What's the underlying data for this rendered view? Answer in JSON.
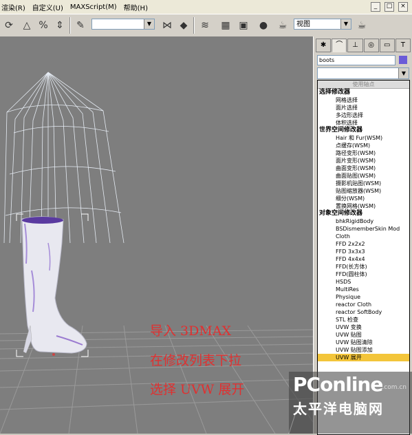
{
  "menubar": {
    "items": [
      "渲染(R)",
      "自定义(U)",
      "MAXScript(M)",
      "帮助(H)"
    ],
    "window_buttons": [
      "_",
      "□",
      "×"
    ]
  },
  "toolbar": {
    "selection_set_value": "",
    "viewport_select_value": "视图"
  },
  "command_panel": {
    "tabs": [
      "create-icon",
      "modify-icon",
      "hierarchy-icon",
      "motion-icon",
      "display-icon",
      "utilities-icon"
    ],
    "object_name": "boots",
    "object_color": "#6a5bd8",
    "modifier_dropdown_value": "",
    "list_header": "使用轴点",
    "groups": [
      {
        "title": "选择修改器",
        "items": [
          "网格选择",
          "面片选择",
          "多边形选择",
          "体积选择"
        ]
      },
      {
        "title": "世界空间修改器",
        "items": [
          "Hair 和 Fur(WSM)",
          "点缓存(WSM)",
          "路径变形(WSM)",
          "面片变形(WSM)",
          "曲面变形(WSM)",
          "曲面贴图(WSM)",
          "摄影机贴图(WSM)",
          "贴图缩放器(WSM)",
          "细分(WSM)",
          "置换网格(WSM)"
        ]
      },
      {
        "title": "对象空间修改器",
        "items": [
          "bhkRigidBody",
          "BSDismemberSkin Mod",
          "Cloth",
          "FFD 2x2x2",
          "FFD 3x3x3",
          "FFD 4x4x4",
          "FFD(长方体)",
          "FFD(圆柱体)",
          "HSDS",
          "MultiRes",
          "Physique",
          "reactor Cloth",
          "reactor SoftBody",
          "STL 检查",
          "UVW 变换",
          "UVW 贴图",
          "UVW 贴图清除",
          "UVW 贴图添加",
          "UVW 展开"
        ]
      }
    ],
    "selected_item": "UVW 展开"
  },
  "annotation": {
    "line1": "导入 3DMAX",
    "line2": "在修改列表下拉",
    "line3": "选择 UVW 展开"
  },
  "watermark": {
    "brand": "PConline",
    "domain": ".com.cn",
    "chinese": "太平洋电脑网"
  }
}
